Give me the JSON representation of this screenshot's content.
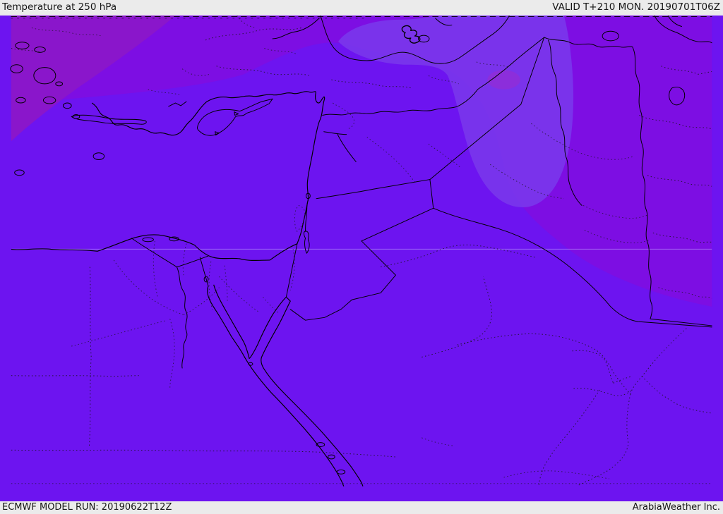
{
  "header": {
    "title": "Temperature at 250 hPa",
    "valid": "VALID T+210 MON. 20190701T06Z"
  },
  "footer": {
    "model_run": "ECMWF MODEL RUN: 20190622T12Z",
    "attribution": "ArabiaWeather Inc."
  },
  "map": {
    "kind": "temperature-shading-map",
    "parameter": "Temperature",
    "level": "250 hPa",
    "model": "ECMWF",
    "shading_regions": [
      {
        "name": "darkest-northwest",
        "color": "#8A16CB"
      },
      {
        "name": "north-purple-band",
        "color": "#7D0EE3"
      },
      {
        "name": "lavender-pocket-anatolia-niraq",
        "color": "#7A36EC"
      },
      {
        "name": "magenta-spot-se-anatolia",
        "color": "#8F2ED8"
      },
      {
        "name": "base-violet-south",
        "color": "#6D14F0"
      }
    ],
    "colors": {
      "bar_bg": "#ebebeb",
      "bar_text": "#161616",
      "base_violet": "#6D14F0",
      "north_purple": "#7D0EE3",
      "dark_magenta": "#8A16CB",
      "lavender_band": "#7A36EC",
      "magenta_spot": "#8F2ED8",
      "coastline": "#000000",
      "gridline": "#c9b6ff"
    }
  }
}
